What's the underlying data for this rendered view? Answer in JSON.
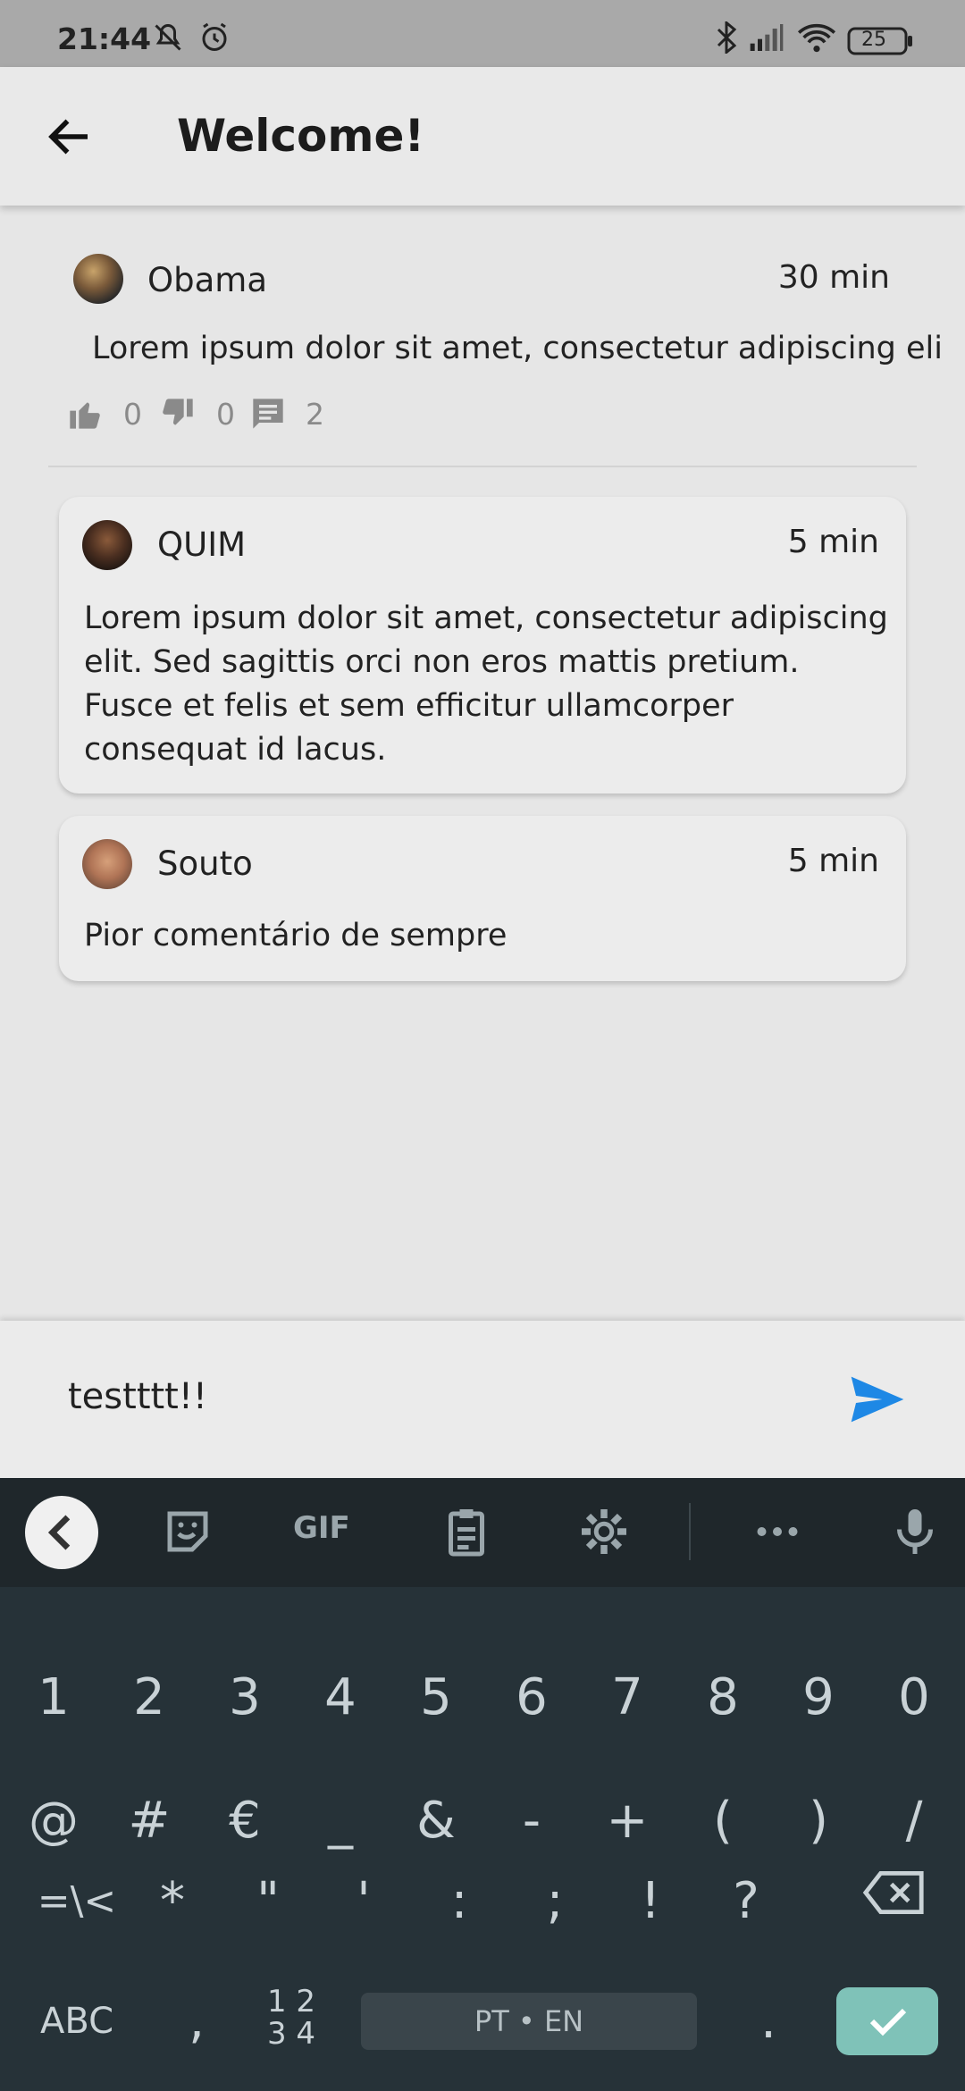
{
  "status_bar": {
    "time": "21:44",
    "battery": "25"
  },
  "header": {
    "title": "Welcome!"
  },
  "post": {
    "author": "Obama",
    "time": "30 min",
    "text": "Lorem ipsum dolor sit amet, consectetur adipiscing eli",
    "likes": "0",
    "dislikes": "0",
    "comments": "2"
  },
  "comments": [
    {
      "author": "QUIM",
      "time": "5 min",
      "text": "Lorem ipsum dolor sit amet, consectetur adipiscing elit. Sed sagittis orci non eros mattis pretium. Fusce et felis et sem efficitur ullamcorper consequat id lacus."
    },
    {
      "author": "Souto",
      "time": "5 min",
      "text": "Pior comentário de sempre"
    }
  ],
  "composer": {
    "value": "testttt!!"
  },
  "keyboard": {
    "toolbar": {
      "gif_label": "GIF"
    },
    "row1": [
      "1",
      "2",
      "3",
      "4",
      "5",
      "6",
      "7",
      "8",
      "9",
      "0"
    ],
    "row2": [
      "@",
      "#",
      "€",
      "_",
      "&",
      "-",
      "+",
      "(",
      ")",
      "/"
    ],
    "row3": [
      "=\\<",
      "*",
      "\"",
      "'",
      ":",
      ";",
      "!",
      "?"
    ],
    "abc_label": "ABC",
    "comma_label": ",",
    "numpad_label": "1 2\n3 4",
    "space_label": "PT • EN",
    "period_label": "."
  }
}
